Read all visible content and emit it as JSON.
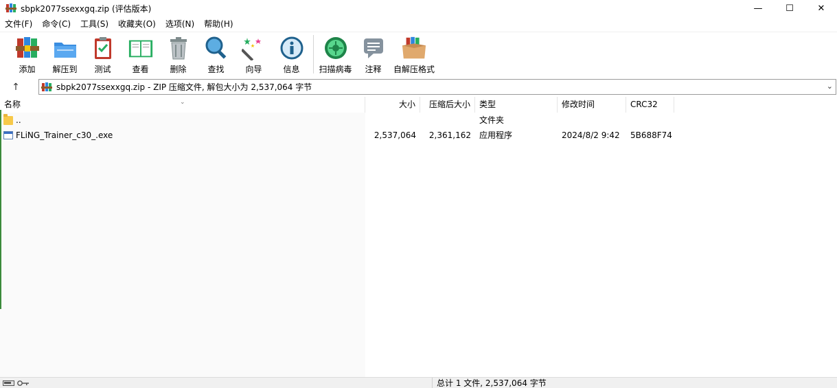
{
  "window": {
    "title": "sbpk2077ssexxgq.zip (评估版本)",
    "controls": {
      "minimize": "—",
      "maximize": "☐",
      "close": "✕"
    }
  },
  "menu": [
    {
      "label": "文件(F)"
    },
    {
      "label": "命令(C)"
    },
    {
      "label": "工具(S)"
    },
    {
      "label": "收藏夹(O)"
    },
    {
      "label": "选项(N)"
    },
    {
      "label": "帮助(H)"
    }
  ],
  "toolbar": [
    {
      "label": "添加",
      "icon": "winrar-books-icon"
    },
    {
      "label": "解压到",
      "icon": "extract-folder-icon"
    },
    {
      "label": "测试",
      "icon": "test-clipboard-icon"
    },
    {
      "label": "查看",
      "icon": "view-book-icon"
    },
    {
      "label": "删除",
      "icon": "trash-icon"
    },
    {
      "label": "查找",
      "icon": "magnifier-icon"
    },
    {
      "label": "向导",
      "icon": "wizard-wand-icon"
    },
    {
      "label": "信息",
      "icon": "info-icon"
    },
    {
      "label": "扫描病毒",
      "icon": "virus-scan-icon"
    },
    {
      "label": "注释",
      "icon": "comment-icon"
    },
    {
      "label": "自解压格式",
      "icon": "sfx-box-icon"
    }
  ],
  "address": {
    "up_label": "↑",
    "text": "sbpk2077ssexxgq.zip - ZIP 压缩文件, 解包大小为 2,537,064 字节",
    "dropdown": "⌄"
  },
  "columns": {
    "name": "名称",
    "size": "大小",
    "packed": "压缩后大小",
    "type": "类型",
    "mtime": "修改时间",
    "crc": "CRC32"
  },
  "files": [
    {
      "name": "..",
      "size": "",
      "packed": "",
      "type": "文件夹",
      "mtime": "",
      "crc": "",
      "kind": "folder"
    },
    {
      "name": "FLiNG_Trainer_c30_.exe",
      "size": "2,537,064",
      "packed": "2,361,162",
      "type": "应用程序",
      "mtime": "2024/8/2 9:42",
      "crc": "5B688F74",
      "kind": "exe"
    }
  ],
  "status": {
    "text": "总计 1 文件, 2,537,064 字节"
  },
  "colors": {
    "folder": "#f7c94a",
    "accent_green": "#3b8a3b"
  }
}
